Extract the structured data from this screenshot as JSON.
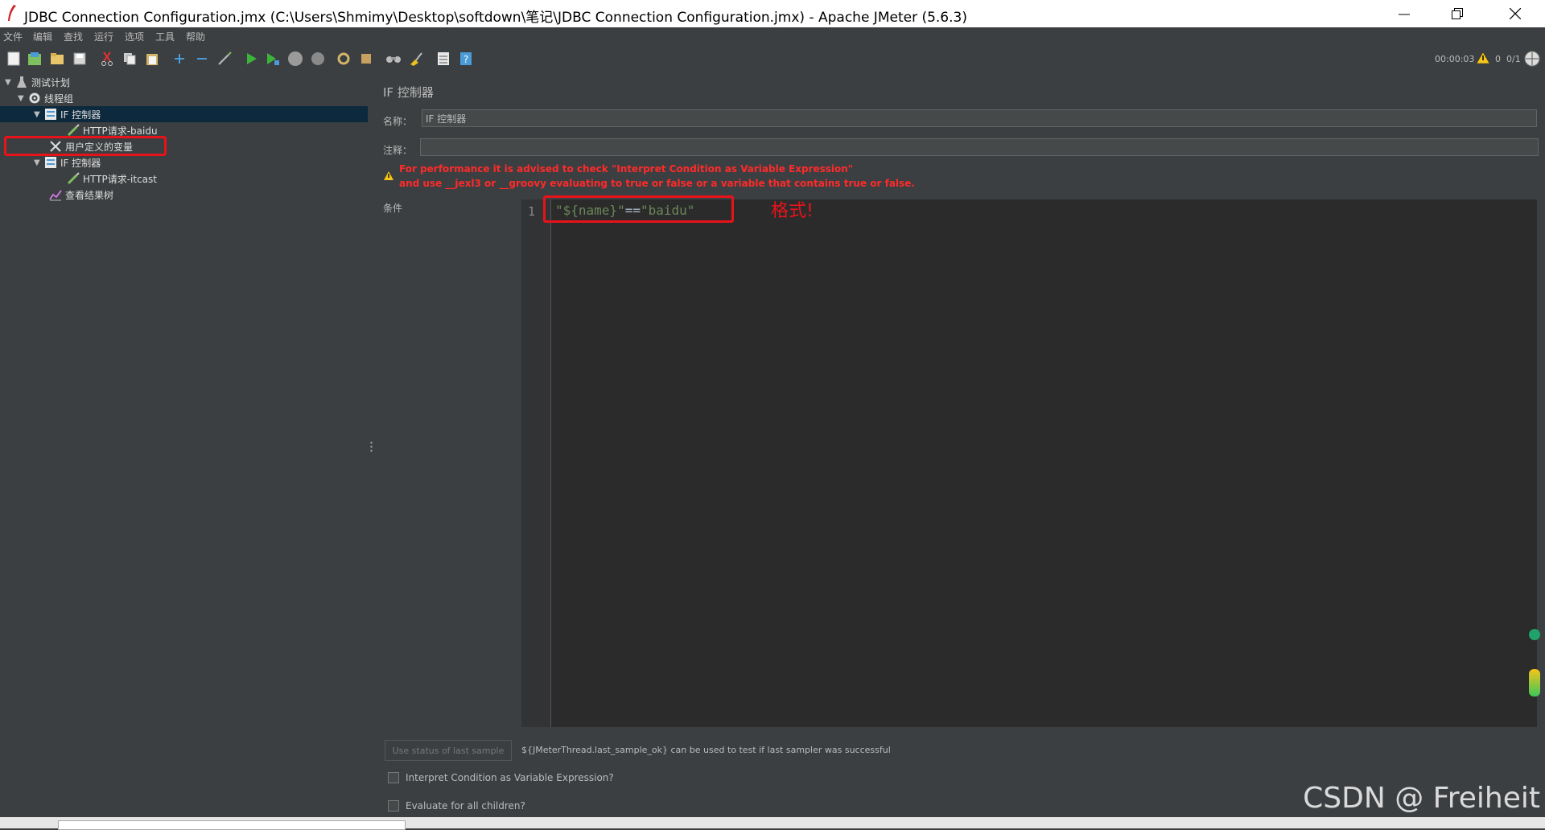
{
  "window": {
    "title": "JDBC Connection Configuration.jmx (C:\\Users\\Shmimy\\Desktop\\softdown\\笔记\\JDBC Connection Configuration.jmx) - Apache JMeter (5.6.3)"
  },
  "menu": [
    "文件",
    "编辑",
    "查找",
    "运行",
    "选项",
    "工具",
    "帮助"
  ],
  "toolbar": {
    "timer": "00:00:03",
    "warnings": "0",
    "threads": "0/1"
  },
  "tree": {
    "test_plan": "测试计划",
    "thread_group": "线程组",
    "if_controller_1": "IF 控制器",
    "http_baidu": "HTTP请求-baidu",
    "user_vars": "用户定义的变量",
    "if_controller_2": "IF 控制器",
    "http_itcast": "HTTP请求-itcast",
    "result_tree": "查看结果树"
  },
  "panel": {
    "heading": "IF 控制器",
    "name_label": "名称：",
    "name_value": "IF 控制器",
    "comment_label": "注释：",
    "comment_value": "",
    "warning_line1": "For performance it is advised to check \"Interpret Condition as Variable Expression\"",
    "warning_line2": "and use __jexl3 or __groovy evaluating to true or false or a variable that contains true or false.",
    "condition_label": "条件",
    "line_number": "1",
    "code_part1": "\"${name}\"",
    "code_part2": "==",
    "code_part3": "\"baidu\"",
    "annotation": "格式!",
    "last_sample_button": "Use status of last sample",
    "last_sample_hint": "${JMeterThread.last_sample_ok} can be used to test if last sampler was successful",
    "interpret_checkbox": "Interpret Condition as Variable Expression?",
    "evaluate_checkbox": "Evaluate for all children?"
  },
  "watermark": "CSDN @ Freiheit",
  "colors": {
    "background": "#3c3f41",
    "editor": "#2b2b2b",
    "string": "#6a8759",
    "warning": "#ff2a2a",
    "highlight": "#e8121a",
    "selection": "#0d293e"
  }
}
